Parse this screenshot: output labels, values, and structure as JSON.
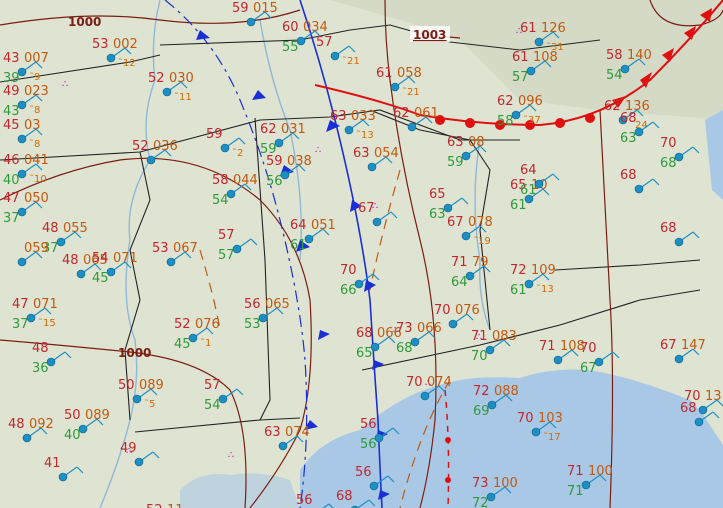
{
  "colors": {
    "land": "#dfe4d2",
    "water": "#a9c8e6",
    "temperature": "#c2272d",
    "dewpoint": "#2e9a3a",
    "pressure": "#c2590f",
    "tendency": "#d46a00",
    "station": "#1d8fc4",
    "isobar": "#7a1d10",
    "state_border": "#222222",
    "cold_front": "#1a2fd6",
    "warm_front": "#e01010",
    "wx_symbol": "#cc00cc"
  },
  "isobar_labels": [
    {
      "text": "1000"
    },
    {
      "text": "1000"
    },
    {
      "text": "1003"
    }
  ],
  "stations": [
    {
      "t": "43",
      "p": "007",
      "d": "39",
      "tend": "-9"
    },
    {
      "t": "49",
      "p": "023",
      "d": "43",
      "tend": "-8"
    },
    {
      "t": "45",
      "p": "03",
      "d": "",
      "tend": "-8"
    },
    {
      "t": "46",
      "p": "041",
      "d": "40",
      "tend": "-10"
    },
    {
      "t": "47",
      "p": "050",
      "d": "37",
      "tend": ""
    },
    {
      "t": "48",
      "p": "055",
      "d": "37",
      "tend": ""
    },
    {
      "t": "",
      "p": "059",
      "d": "",
      "tend": ""
    },
    {
      "t": "48",
      "p": "065",
      "d": "",
      "tend": ""
    },
    {
      "t": "47",
      "p": "071",
      "d": "37",
      "tend": "-15"
    },
    {
      "t": "48",
      "p": "",
      "d": "36",
      "tend": ""
    },
    {
      "t": "53",
      "p": "002",
      "d": "",
      "tend": "-12"
    },
    {
      "t": "52",
      "p": "030",
      "d": "",
      "tend": "-11"
    },
    {
      "t": "52",
      "p": "036",
      "d": "",
      "tend": ""
    },
    {
      "t": "54",
      "p": "071",
      "d": "45",
      "tend": ""
    },
    {
      "t": "53",
      "p": "067",
      "d": "",
      "tend": ""
    },
    {
      "t": "50",
      "p": "089",
      "d": "",
      "tend": "-5"
    },
    {
      "t": "48",
      "p": "092",
      "d": "",
      "tend": ""
    },
    {
      "t": "50",
      "p": "089",
      "d": "40",
      "tend": ""
    },
    {
      "t": "59",
      "p": "",
      "d": "",
      "tend": "-2"
    },
    {
      "t": "58",
      "p": "044",
      "d": "54",
      "tend": ""
    },
    {
      "t": "57",
      "p": "",
      "d": "57",
      "tend": ""
    },
    {
      "t": "56",
      "p": "065",
      "d": "53",
      "tend": ""
    },
    {
      "t": "52",
      "p": "076",
      "d": "45",
      "tend": "-1"
    },
    {
      "t": "57",
      "p": "",
      "d": "54",
      "tend": ""
    },
    {
      "t": "49",
      "p": "",
      "d": "",
      "tend": ""
    },
    {
      "t": "41",
      "p": "",
      "d": "",
      "tend": ""
    },
    {
      "t": "60",
      "p": "034",
      "d": "55",
      "tend": ""
    },
    {
      "t": "59",
      "p": "015",
      "d": "",
      "tend": ""
    },
    {
      "t": "57",
      "p": "",
      "d": "",
      "tend": "-21"
    },
    {
      "t": "62",
      "p": "031",
      "d": "59",
      "tend": ""
    },
    {
      "t": "59",
      "p": "038",
      "d": "56",
      "tend": ""
    },
    {
      "t": "64",
      "p": "051",
      "d": "61",
      "tend": ""
    },
    {
      "t": "63",
      "p": "033",
      "d": "",
      "tend": "-13"
    },
    {
      "t": "63",
      "p": "054",
      "d": "",
      "tend": ""
    },
    {
      "t": "61",
      "p": "058",
      "d": "",
      "tend": "-21"
    },
    {
      "t": "67",
      "p": "",
      "d": "",
      "tend": ""
    },
    {
      "t": "70",
      "p": "",
      "d": "66",
      "tend": ""
    },
    {
      "t": "68",
      "p": "066",
      "d": "65",
      "tend": ""
    },
    {
      "t": "63",
      "p": "074",
      "d": "",
      "tend": ""
    },
    {
      "t": "56",
      "p": "",
      "d": "56",
      "tend": ""
    },
    {
      "t": "62",
      "p": "061",
      "d": "",
      "tend": ""
    },
    {
      "t": "63",
      "p": "08",
      "d": "59",
      "tend": ""
    },
    {
      "t": "65",
      "p": "",
      "d": "63",
      "tend": ""
    },
    {
      "t": "67",
      "p": "078",
      "d": "",
      "tend": "-19"
    },
    {
      "t": "71",
      "p": "79",
      "d": "64",
      "tend": ""
    },
    {
      "t": "70",
      "p": "076",
      "d": "",
      "tend": ""
    },
    {
      "t": "73",
      "p": "066",
      "d": "68",
      "tend": ""
    },
    {
      "t": "71",
      "p": "083",
      "d": "70",
      "tend": ""
    },
    {
      "t": "70",
      "p": "074",
      "d": "",
      "tend": ""
    },
    {
      "t": "72",
      "p": "088",
      "d": "69",
      "tend": ""
    },
    {
      "t": "61",
      "p": "108",
      "d": "57",
      "tend": ""
    },
    {
      "t": "62",
      "p": "096",
      "d": "58",
      "tend": "-37"
    },
    {
      "t": "65",
      "p": "10",
      "d": "61",
      "tend": ""
    },
    {
      "t": "72",
      "p": "109",
      "d": "61",
      "tend": "-13"
    },
    {
      "t": "61",
      "p": "126",
      "d": "",
      "tend": "-31"
    },
    {
      "t": "58",
      "p": "140",
      "d": "54",
      "tend": ""
    },
    {
      "t": "62",
      "p": "136",
      "d": "",
      "tend": "-24"
    },
    {
      "t": "64",
      "p": "",
      "d": "61",
      "tend": ""
    },
    {
      "t": "71",
      "p": "108",
      "d": "",
      "tend": ""
    },
    {
      "t": "70",
      "p": "",
      "d": "67",
      "tend": ""
    },
    {
      "t": "70",
      "p": "103",
      "d": "",
      "tend": "-17"
    },
    {
      "t": "73",
      "p": "100",
      "d": "72",
      "tend": ""
    },
    {
      "t": "71",
      "p": "100",
      "d": "71",
      "tend": ""
    },
    {
      "t": "68",
      "p": "",
      "d": "63",
      "tend": ""
    },
    {
      "t": "68",
      "p": "",
      "d": "",
      "tend": ""
    },
    {
      "t": "70",
      "p": "",
      "d": "68",
      "tend": ""
    },
    {
      "t": "67",
      "p": "147",
      "d": "",
      "tend": ""
    },
    {
      "t": "68",
      "p": "",
      "d": "",
      "tend": ""
    },
    {
      "t": "68",
      "p": "",
      "d": "",
      "tend": ""
    },
    {
      "t": "70",
      "p": "13",
      "d": "",
      "tend": ""
    },
    {
      "t": "56",
      "p": "",
      "d": "",
      "tend": ""
    },
    {
      "t": "68",
      "p": "",
      "d": "",
      "tend": ""
    },
    {
      "t": "56",
      "p": "",
      "d": "",
      "tend": ""
    },
    {
      "t": "52",
      "p": "11",
      "d": "",
      "tend": ""
    }
  ]
}
